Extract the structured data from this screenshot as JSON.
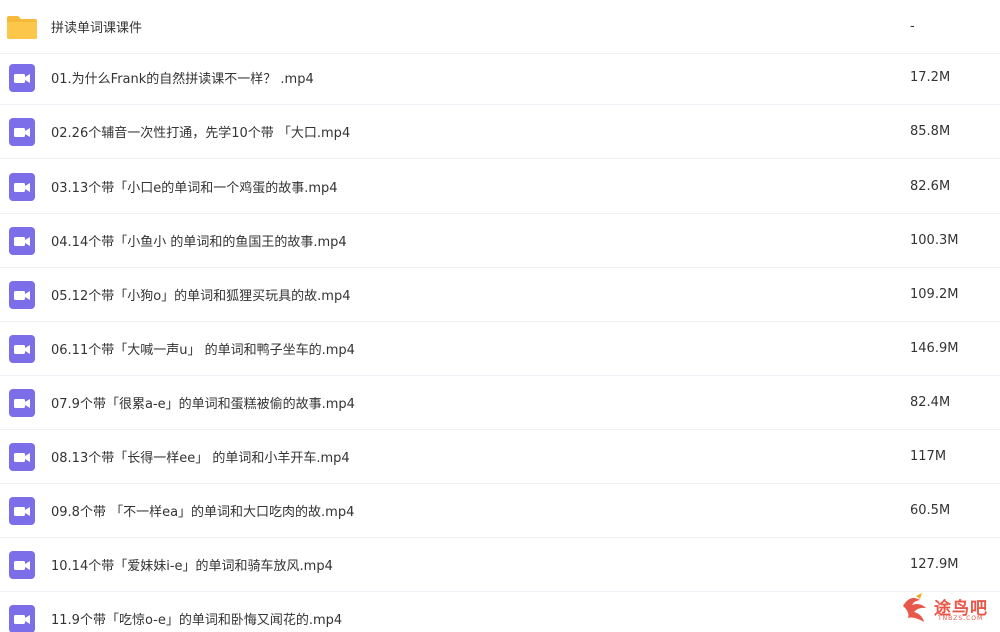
{
  "folder": {
    "name": "拼读单词课课件",
    "size": "-",
    "icon": "folder-icon",
    "color": "#fcc64a"
  },
  "files": [
    {
      "name": "01.为什么Frank的自然拼读课不一样？ .mp4",
      "size": "17.2M"
    },
    {
      "name": "02.26个辅音一次性打通，先学10个带 「大口.mp4",
      "size": "85.8M"
    },
    {
      "name": "03.13个带「小口e的单词和一个鸡蛋的故事.mp4",
      "size": "82.6M"
    },
    {
      "name": "04.14个带「小鱼小 的单词和的鱼国王的故事.mp4",
      "size": "100.3M"
    },
    {
      "name": "05.12个带「小狗o」的单词和狐狸买玩具的故.mp4",
      "size": "109.2M"
    },
    {
      "name": "06.11个带「大喊一声u」 的单词和鸭子坐车的.mp4",
      "size": "146.9M"
    },
    {
      "name": "07.9个带「很累a-e」的单词和蛋糕被偷的故事.mp4",
      "size": "82.4M"
    },
    {
      "name": "08.13个带「长得一样ee」 的单词和小羊开车.mp4",
      "size": "117M"
    },
    {
      "name": "09.8个带 「不一样ea」的单词和大口吃肉的故.mp4",
      "size": "60.5M"
    },
    {
      "name": "10.14个带「爱妹妹i-e」的单词和骑车放风.mp4",
      "size": "127.9M"
    },
    {
      "name": "11.9个带「吃惊o-e」的单词和卧悔又闻花的.mp4",
      "size": ""
    }
  ],
  "video_icon": {
    "name": "video-file-icon",
    "color": "#7b6ee8"
  },
  "watermark": {
    "text": "途鸟吧",
    "sub": "TNBZS.COM",
    "color": "#e8584a"
  }
}
